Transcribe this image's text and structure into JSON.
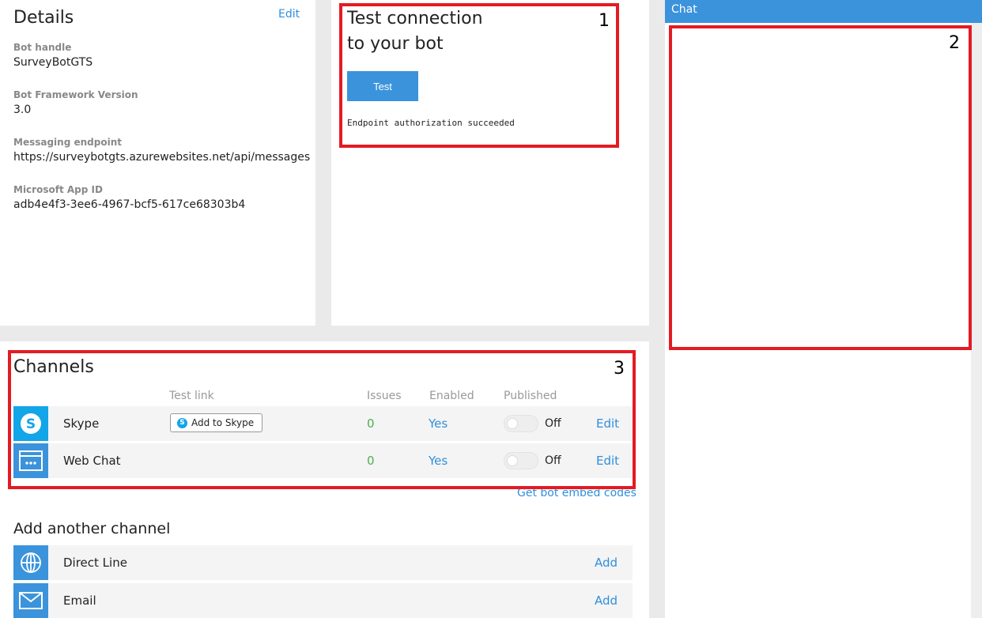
{
  "details": {
    "title": "Details",
    "edit": "Edit",
    "fields": [
      {
        "label": "Bot handle",
        "value": "SurveyBotGTS"
      },
      {
        "label": "Bot Framework Version",
        "value": "3.0"
      },
      {
        "label": "Messaging endpoint",
        "value": "https://surveybotgts.azurewebsites.net/api/messages"
      },
      {
        "label": "Microsoft App ID",
        "value": "adb4e4f3-3ee6-4967-bcf5-617ce68303b4"
      }
    ]
  },
  "test": {
    "title": "Test connection to your bot",
    "button": "Test",
    "status": "Endpoint authorization succeeded"
  },
  "chat": {
    "header": "Chat"
  },
  "channels": {
    "title": "Channels",
    "columns": {
      "test_link": "Test link",
      "issues": "Issues",
      "enabled": "Enabled",
      "published": "Published"
    },
    "rows": [
      {
        "name": "Skype",
        "icon": "skype-icon",
        "test_link": "Add to Skype",
        "issues": "0",
        "enabled": "Yes",
        "published": "Off",
        "edit": "Edit",
        "color": "#12a5e8"
      },
      {
        "name": "Web Chat",
        "icon": "web-chat-icon",
        "issues": "0",
        "enabled": "Yes",
        "published": "Off",
        "edit": "Edit",
        "color": "#3b93dc"
      }
    ],
    "embed_link": "Get bot embed codes"
  },
  "add_channel": {
    "title": "Add another channel",
    "rows": [
      {
        "name": "Direct Line",
        "icon": "globe-icon",
        "action": "Add"
      },
      {
        "name": "Email",
        "icon": "mail-icon",
        "action": "Add"
      }
    ]
  },
  "annotations": [
    "1",
    "2",
    "3"
  ],
  "colors": {
    "accent": "#3b93dc",
    "annotation": "#e31b23",
    "ok": "#4caf50"
  }
}
